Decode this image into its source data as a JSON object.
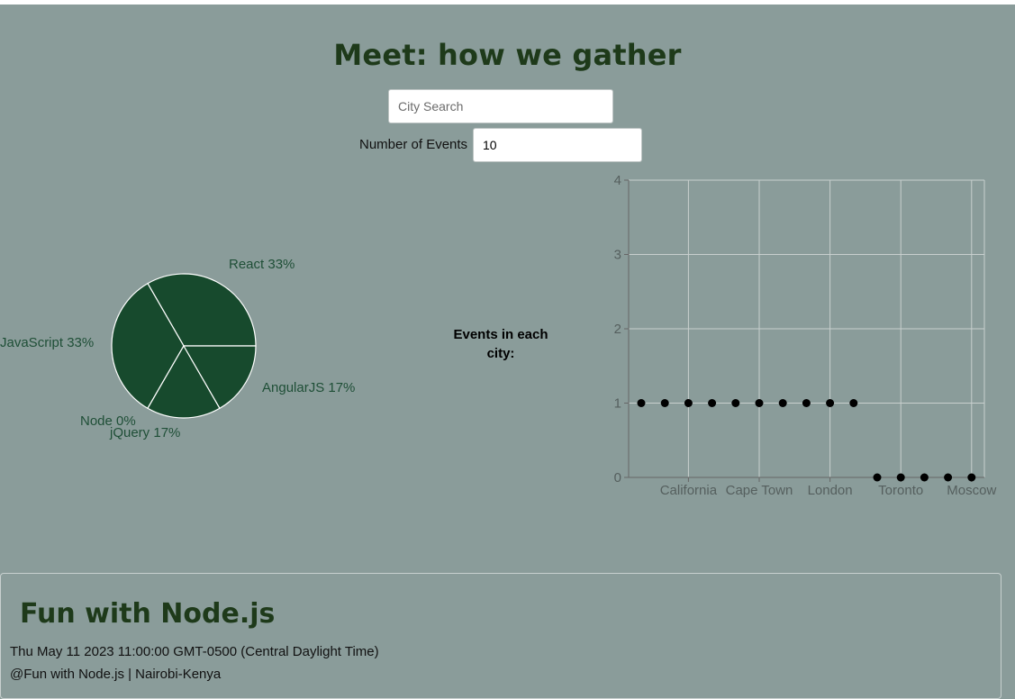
{
  "page": {
    "title": "Meet: how we gather"
  },
  "search": {
    "placeholder": "City Search",
    "value": ""
  },
  "events": {
    "label": "Number of Events",
    "value": "10"
  },
  "pie_chart": {
    "labels": [
      "React 33%",
      "AngularJS 17%",
      "jQuery 17%",
      "Node 0%",
      "JavaScript 33%"
    ]
  },
  "scatter_chart": {
    "title": "Events in each city:"
  },
  "footer": {
    "title": "Fun with Node.js",
    "date": "Thu May 11 2023 11:00:00 GMT-0500 (Central Daylight Time)",
    "copyright": "@Fun with Node.js | Nairobi-Kenya"
  },
  "colors": {
    "background": "#8a9c9a",
    "title": "#1e3a1a",
    "pie_fill": "#174a2d",
    "pie_label": "#1f4f37",
    "dot": "#000000",
    "grid": "#c8cfce"
  },
  "chart_data": [
    {
      "type": "pie",
      "categories": [
        "React",
        "AngularJS",
        "jQuery",
        "Node",
        "JavaScript"
      ],
      "values": [
        33.33,
        16.67,
        16.67,
        0,
        33.33
      ],
      "labels": [
        "React 33%",
        "AngularJS 17%",
        "jQuery 17%",
        "Node 0%",
        "JavaScript 33%"
      ]
    },
    {
      "type": "scatter",
      "title": "Events in each city:",
      "x": [
        "",
        "",
        "California",
        "",
        "",
        "Cape Town",
        "",
        "",
        "London",
        "",
        "",
        "Toronto",
        "",
        "",
        "Moscow"
      ],
      "tick_labels": [
        "California",
        "Cape Town",
        "London",
        "Toronto",
        "Moscow"
      ],
      "values": [
        1,
        1,
        1,
        1,
        1,
        1,
        1,
        1,
        1,
        1,
        0,
        0,
        0,
        0,
        0
      ],
      "ylim": [
        0,
        4
      ],
      "yticks": [
        0,
        1,
        2,
        3,
        4
      ],
      "grid": true
    }
  ]
}
